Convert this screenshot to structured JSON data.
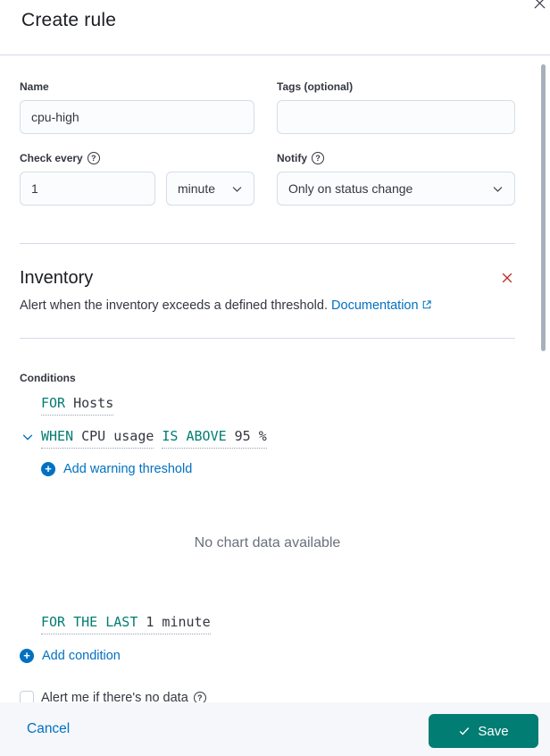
{
  "dialog": {
    "title": "Create rule"
  },
  "icons": {
    "help": "?",
    "plus": "+"
  },
  "form": {
    "name_label": "Name",
    "name_value": "cpu-high",
    "tags_label": "Tags (optional)",
    "tags_value": "",
    "check_every_label": "Check every",
    "check_every_value": "1",
    "check_every_unit": "minute",
    "notify_label": "Notify",
    "notify_value": "Only on status change"
  },
  "rule": {
    "title": "Inventory",
    "description": "Alert when the inventory exceeds a defined threshold.",
    "doc_link_label": "Documentation"
  },
  "conditions": {
    "section_label": "Conditions",
    "for_keyword": "FOR",
    "for_value": "Hosts",
    "when_keyword": "WHEN",
    "when_metric": "CPU usage",
    "comparator_keyword": "IS ABOVE",
    "threshold_value": "95 %",
    "add_warning_label": "Add warning threshold",
    "chart_empty_text": "No chart data available",
    "window_keyword": "FOR THE LAST",
    "window_value": "1 minute",
    "add_condition_label": "Add condition",
    "no_data_label": "Alert me if there's no data"
  },
  "footer": {
    "cancel_label": "Cancel",
    "save_label": "Save"
  }
}
